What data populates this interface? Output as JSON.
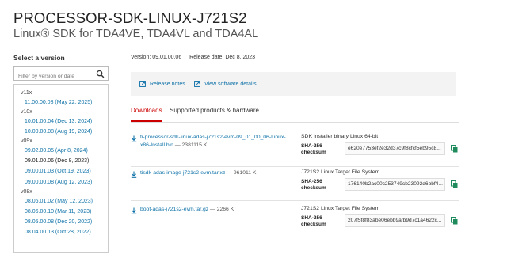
{
  "header": {
    "title": "PROCESSOR-SDK-LINUX-J721S2",
    "subtitle": "Linux® SDK for TDA4VE, TDA4VL and TDA4AL"
  },
  "sidebar": {
    "select_label": "Select a version",
    "filter_placeholder": "Filter by version or date",
    "groups": [
      {
        "label": "v11x",
        "items": [
          "11.00.00.08 (May 22, 2025)"
        ]
      },
      {
        "label": "v10x",
        "items": [
          "10.01.00.04 (Dec 13, 2024)",
          "10.00.00.08 (Aug 19, 2024)"
        ]
      },
      {
        "label": "v09x",
        "items": [
          "09.02.00.05 (Apr 8, 2024)",
          "09.01.00.06 (Dec 8, 2023)",
          "09.00.01.03 (Oct 19, 2023)",
          "09.00.00.08 (Aug 12, 2023)"
        ]
      },
      {
        "label": "v08x",
        "items": [
          "08.06.01.02 (May 12, 2023)",
          "08.06.00.10 (Mar 11, 2023)",
          "08.05.00.08 (Dec 20, 2022)",
          "08.04.00.13 (Oct 28, 2022)"
        ]
      }
    ],
    "selected_item": "09.01.00.06 (Dec 8, 2023)"
  },
  "meta": {
    "version": "Version: 09.01.00.06",
    "release_date": "Release date: Dec 8, 2023"
  },
  "links": {
    "release_notes": "Release notes",
    "software_details": "View software details"
  },
  "tabs": {
    "downloads": "Downloads",
    "supported": "Supported products & hardware"
  },
  "downloads": [
    {
      "filename": "ti-processor-sdk-linux-adas-j721s2-evm-09_01_00_06-Linux-x86-Install.bin",
      "size": "— 2381115 K",
      "description": "SDK Installer binary Linux 64-bit",
      "sha_label_1": "SHA-256",
      "sha_label_2": "checksum",
      "sha": "e620e7753ef2e32d37c9f8cfcf5eb95c8..."
    },
    {
      "filename": "tisdk-adas-image-j721s2-evm.tar.xz",
      "size": "— 961011 K",
      "description": "J721S2 Linux Target File System",
      "sha_label_1": "SHA-256",
      "sha_label_2": "checksum",
      "sha": "176140b2ac00c253749cb23092d6bbf4..."
    },
    {
      "filename": "boot-adas-j721s2-evm.tar.gz",
      "size": "— 2266 K",
      "description": "J721S2 Linux Target File System",
      "sha_label_1": "SHA-256",
      "sha_label_2": "checksum",
      "sha": "207f5f8f83abe06ebb9afb9d7c1a4622c..."
    }
  ],
  "colors": {
    "link": "#0f72a8",
    "active_tab": "#cc0000",
    "copy_icon": "#1f8a5b"
  }
}
